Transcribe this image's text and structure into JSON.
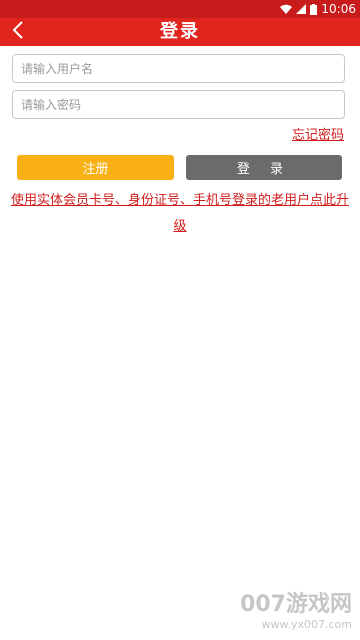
{
  "status_bar": {
    "time": "10:06"
  },
  "app_bar": {
    "title": "登录",
    "back_icon": "chevron-left-icon"
  },
  "form": {
    "username_placeholder": "请输入用户名",
    "password_placeholder": "请输入密码",
    "forgot_password": "忘记密码",
    "register_label": "注册",
    "login_label": "登 录",
    "upgrade_link": "使用实体会员卡号、身份证号、手机号登录的老用户点此升级"
  },
  "colors": {
    "primary": "#e0251f",
    "register": "#f9b014",
    "login": "#6b6b6b",
    "link": "#d01c1c"
  },
  "watermark": {
    "main": "007游戏网",
    "url": "www.yx007.com"
  }
}
